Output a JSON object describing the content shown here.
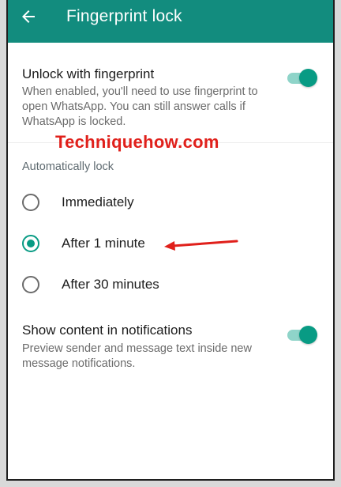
{
  "app_bar": {
    "title": "Fingerprint lock",
    "back_icon": "arrow-left-icon",
    "color": "#128c7e"
  },
  "unlock_setting": {
    "title": "Unlock with fingerprint",
    "description": "When enabled, you'll need to use fingerprint to open WhatsApp. You can still answer calls if WhatsApp is locked.",
    "enabled": true
  },
  "watermark": "Techniquehow.com",
  "auto_lock": {
    "label": "Automatically lock",
    "options": [
      {
        "label": "Immediately",
        "selected": false
      },
      {
        "label": "After 1 minute",
        "selected": true
      },
      {
        "label": "After 30 minutes",
        "selected": false
      }
    ]
  },
  "notifications_setting": {
    "title": "Show content in notifications",
    "description": "Preview sender and message text inside new message notifications.",
    "enabled": true
  },
  "colors": {
    "accent": "#089b84",
    "annotation_arrow": "#e0201b"
  }
}
